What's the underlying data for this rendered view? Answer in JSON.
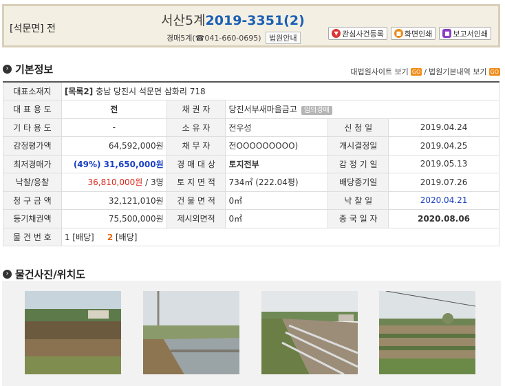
{
  "header": {
    "land_type": "[석문면] 전",
    "court": "서산5계",
    "case_no": "2019-3351(2)",
    "contact": "경매5계(☎041-660-0695)",
    "court_guide": "법원안내",
    "buttons": [
      "관심사건등록",
      "화면인쇄",
      "보고서인쇄"
    ]
  },
  "basic": {
    "title": "기본정보",
    "link1": "대법원사이트 보기",
    "go": "GO",
    "sep": "/",
    "link2": "법원기본내역 보기"
  },
  "table": {
    "address_label": "대표소재지",
    "address_prefix": "[목록2]",
    "address": "충남 당진시 석문면 삼화리 718",
    "rows": [
      {
        "l1": "대 표 용 도",
        "v1": "전",
        "l2": "채 권 자",
        "v2": "당진서부새마을금고",
        "tag": "임의경매"
      },
      {
        "l1": "기 타 용 도",
        "v1": "-",
        "l2": "소 유 자",
        "v2": "전우성",
        "l3": "신 청 일",
        "v3": "2019.04.24"
      },
      {
        "l1": "감정평가액",
        "v1": "64,592,000원",
        "l2": "채 무 자",
        "v2": "전OOOOOOOOO)",
        "l3": "개시결정일",
        "v3": "2019.04.25"
      },
      {
        "l1": "최저경매가",
        "v1": "(49%) 31,650,000원",
        "l2": "경 매 대 상",
        "v2": "토지전부",
        "l3": "감 정 기 일",
        "v3": "2019.05.13"
      },
      {
        "l1": "낙찰/응찰",
        "v1a": "36,810,000원",
        "v1b": " / 3명",
        "l2": "토 지 면 적",
        "v2": "734㎡ (222.04평)",
        "l3": "배당종기일",
        "v3": "2019.07.26"
      },
      {
        "l1": "청 구 금 액",
        "v1": "32,121,010원",
        "l2": "건 물 면 적",
        "v2": "0㎡",
        "l3": "낙 찰 일",
        "v3": "2020.04.21"
      },
      {
        "l1": "등기채권액",
        "v1": "75,500,000원",
        "l2": "제시외면적",
        "v2": "0㎡",
        "l3": "종 국 일 자",
        "v3": "2020.08.06"
      }
    ],
    "items_label": "물 건 번 호",
    "item1": "1 [배당]",
    "item2_no": "2",
    "item2_text": " [배당]"
  },
  "photos": {
    "title": "물건사진/위치도"
  }
}
